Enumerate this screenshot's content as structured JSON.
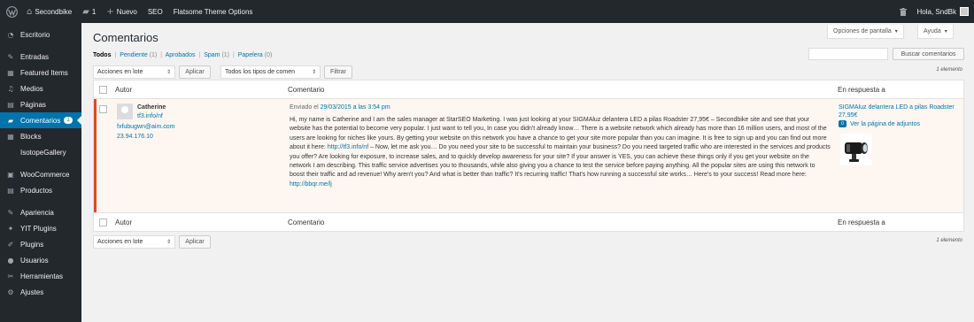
{
  "adminbar": {
    "site_name": "Secondbike",
    "comments_count": "1",
    "new_label": "Nuevo",
    "seo_label": "SEO",
    "flatsome_label": "Flatsome Theme Options",
    "greeting": "Hola, SndBk"
  },
  "sidebar": {
    "items": [
      {
        "label": "Escritorio",
        "icon": "dashboard-icon"
      },
      {
        "label": "Entradas",
        "icon": "pin-icon"
      },
      {
        "label": "Featured Items",
        "icon": "portfolio-icon"
      },
      {
        "label": "Medios",
        "icon": "media-icon"
      },
      {
        "label": "Páginas",
        "icon": "page-icon"
      },
      {
        "label": "Comentarios",
        "icon": "comments-icon",
        "badge": "1",
        "current": true
      },
      {
        "label": "Blocks",
        "icon": "blocks-icon"
      },
      {
        "label": "IsotopeGallery",
        "icon": "gallery-icon"
      },
      {
        "label": "WooCommerce",
        "icon": "woocommerce-icon"
      },
      {
        "label": "Productos",
        "icon": "products-icon"
      },
      {
        "label": "Apariencia",
        "icon": "appearance-icon"
      },
      {
        "label": "YIT Plugins",
        "icon": "yit-icon"
      },
      {
        "label": "Plugins",
        "icon": "plugins-icon"
      },
      {
        "label": "Usuarios",
        "icon": "users-icon"
      },
      {
        "label": "Herramientas",
        "icon": "tools-icon"
      },
      {
        "label": "Ajustes",
        "icon": "settings-icon"
      }
    ]
  },
  "screen_options": {
    "label": "Opciones de pantalla"
  },
  "help": {
    "label": "Ayuda"
  },
  "page": {
    "title": "Comentarios"
  },
  "filters": {
    "todos": "Todos",
    "pendiente": "Pendiente",
    "pendiente_count": "(1)",
    "aprobados": "Aprobados",
    "spam": "Spam",
    "spam_count": "(1)",
    "papelera": "Papelera",
    "papelera_count": "(0)",
    "sep": "|"
  },
  "search": {
    "button": "Buscar comentarios",
    "value": ""
  },
  "bulk": {
    "selected": "Acciones en lote",
    "apply": "Aplicar"
  },
  "type_filter": {
    "selected": "Todos los tipos de comen",
    "button": "Filtrar"
  },
  "items_count": "1 elemento",
  "table": {
    "headers": {
      "author": "Autor",
      "comment": "Comentario",
      "response": "En respuesta a"
    }
  },
  "comment": {
    "author": "Catherine",
    "url": "tf3.info/nf",
    "email": "fxfubugwn@aim.com",
    "ip": "23.94.176.10",
    "submitted_prefix": "Enviado el",
    "date": "29/03/2015 a las 3:54 pm",
    "text_main": "Hi, my name is Catherine and I am the sales manager at StarSEO Marketing. I was just looking at your SIGMAluz delantera LED a pilas Roadster 27,95€ – Secondbike site and see that your website has the potential to become very popular. I just want to tell you, In case you didn't already know… There is a website network which already has more than 16 million users, and most of the users are looking for niches like yours. By getting your website on this network you have a chance to get your site more popular than you can imagine. It is free to sign up and you can find out more about it here:",
    "link1": "http://tf3.info/nf",
    "text_mid": "– Now, let me ask you… Do you need your site to be successful to maintain your business? Do you need targeted traffic who are interested in the services and products you offer? Are looking for exposure, to increase sales, and to quickly develop awareness for your site? If your answer is YES, you can achieve these things only if you get your website on the network I am describing. This traffic service advertises you to thousands, while also giving you a chance to test the service before paying anything. All the popular sites are using this network to boost their traffic and ad revenue! Why aren't you? And what is better than traffic? It's recurring traffic! That's how running a successful site works… Here's to your success! Read more here:",
    "link2": "http://bbqr.me/lj",
    "in_response_to": "SIGMAluz delantera LED a pilas Roadster 27,95€",
    "view_attachment": "Ver la página de adjuntos",
    "bubble_count": "0"
  },
  "colors": {
    "accent": "#0073aa",
    "sidebar_bg": "#23282d",
    "unapproved_border": "#d54e21",
    "unapproved_bg": "#fef7f1"
  }
}
